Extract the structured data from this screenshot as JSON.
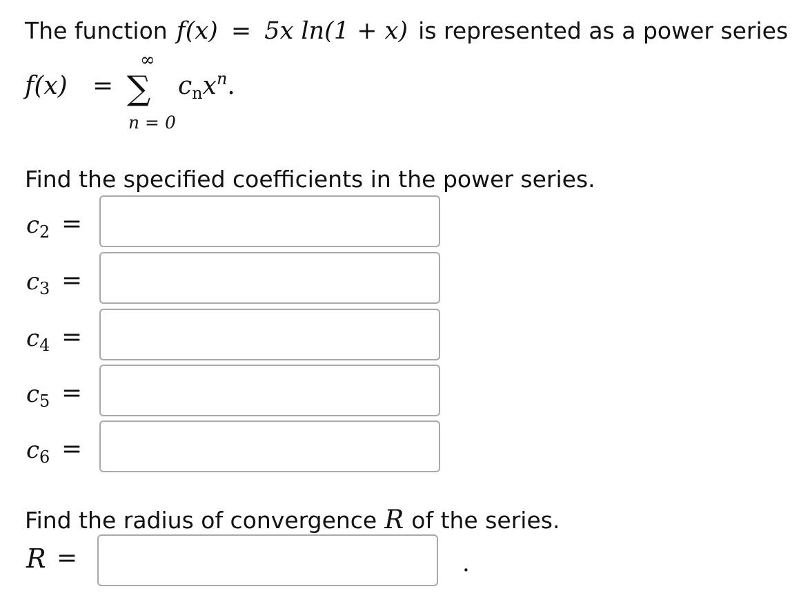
{
  "intro": {
    "lead": "The function",
    "f_of_x": "f(x)",
    "equals": "=",
    "formula": "5x ln(1 + x)",
    "tail": "is represented as a power series"
  },
  "series": {
    "lhs": "f(x)",
    "equals": "=",
    "sigma": "∑",
    "upper": "∞",
    "lower": "n = 0",
    "term_base": "c",
    "term_sub": "n",
    "term_var": "x",
    "term_sup": "n",
    "period": "."
  },
  "coefficients": {
    "prompt": "Find the specified coefficients in the power series.",
    "items": [
      {
        "symbol": "c",
        "index": "2",
        "equals": "=",
        "value": "",
        "placeholder": ""
      },
      {
        "symbol": "c",
        "index": "3",
        "equals": "=",
        "value": "",
        "placeholder": ""
      },
      {
        "symbol": "c",
        "index": "4",
        "equals": "=",
        "value": "",
        "placeholder": ""
      },
      {
        "symbol": "c",
        "index": "5",
        "equals": "=",
        "value": "",
        "placeholder": ""
      },
      {
        "symbol": "c",
        "index": "6",
        "equals": "=",
        "value": "",
        "placeholder": ""
      }
    ]
  },
  "radius": {
    "prompt_before": "Find the radius of convergence",
    "symbol": "R",
    "prompt_after": "of the series.",
    "label": "R",
    "equals": "=",
    "value": "",
    "placeholder": "",
    "trailing": "."
  }
}
